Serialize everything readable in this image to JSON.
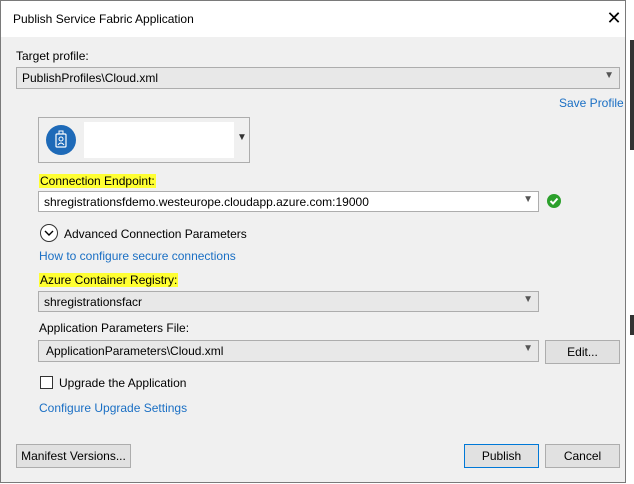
{
  "window": {
    "title": "Publish Service Fabric Application",
    "close_glyph": "✕"
  },
  "target_profile": {
    "label": "Target profile:",
    "value": "PublishProfiles\\Cloud.xml"
  },
  "save_profile": "Save Profile",
  "account": {
    "avatar_color": "#1e6ab8"
  },
  "connection": {
    "label": "Connection Endpoint:",
    "value": "shregistrationsfdemo.westeurope.cloudapp.azure.com:19000",
    "status_icon": "check-circle-icon",
    "status_color": "#2ca02c"
  },
  "advanced": {
    "label": "Advanced Connection Parameters"
  },
  "secure_link": "How to configure secure connections",
  "registry": {
    "label": "Azure Container Registry:",
    "value": "shregistrationsfacr"
  },
  "app_params": {
    "label": "Application Parameters File:",
    "value": "ApplicationParameters\\Cloud.xml",
    "edit_label": "Edit..."
  },
  "upgrade": {
    "label": "Upgrade the Application",
    "checked": false
  },
  "configure_upgrade": "Configure Upgrade Settings",
  "buttons": {
    "manifest": "Manifest Versions...",
    "publish": "Publish",
    "cancel": "Cancel"
  },
  "colors": {
    "highlight": "#ffff33",
    "link": "#1a6fc4",
    "accent": "#0078d7"
  }
}
